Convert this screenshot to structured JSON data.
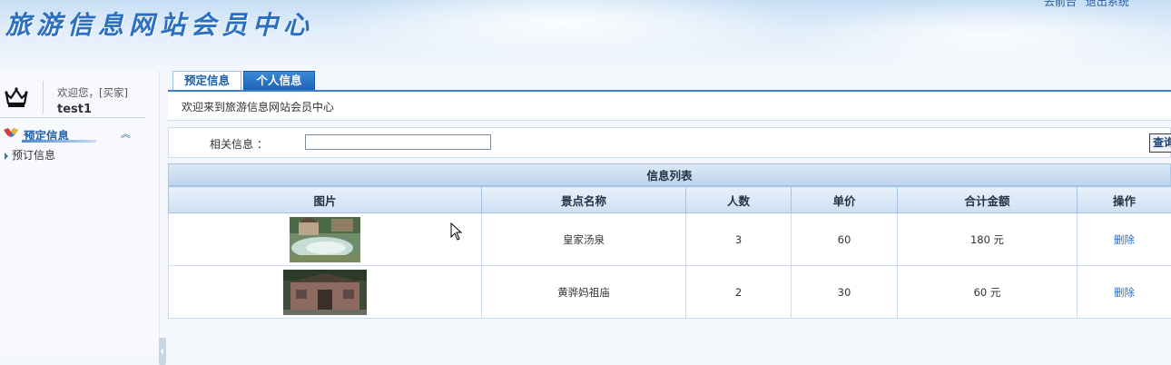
{
  "header": {
    "site_title": "旅游信息网站会员中心",
    "links": [
      "去前台",
      "退出系统"
    ]
  },
  "sidebar": {
    "welcome_text": "欢迎您，[买家]",
    "username": "test1",
    "section_title": "预定信息",
    "items": [
      {
        "label": "预订信息"
      }
    ]
  },
  "tabs": [
    {
      "label": "预定信息",
      "active": true
    },
    {
      "label": "个人信息",
      "active": false
    }
  ],
  "welcome_message": "欢迎来到旅游信息网站会员中心",
  "search": {
    "label": "相关信息 ：",
    "value": "",
    "button_label": "查询"
  },
  "list": {
    "title": "信息列表",
    "columns": [
      "图片",
      "景点名称",
      "人数",
      "单价",
      "合计金额",
      "操作"
    ],
    "rows": [
      {
        "image": "hot-spring-photo",
        "name": "皇家汤泉",
        "people": "3",
        "unit_price": "60",
        "total": "180 元",
        "action": "删除"
      },
      {
        "image": "temple-photo",
        "name": "黄骅妈祖庙",
        "people": "2",
        "unit_price": "30",
        "total": "60 元",
        "action": "删除"
      }
    ]
  },
  "colors": {
    "accent": "#2a6fc0",
    "tab_active_bg": "#1e63b4"
  }
}
